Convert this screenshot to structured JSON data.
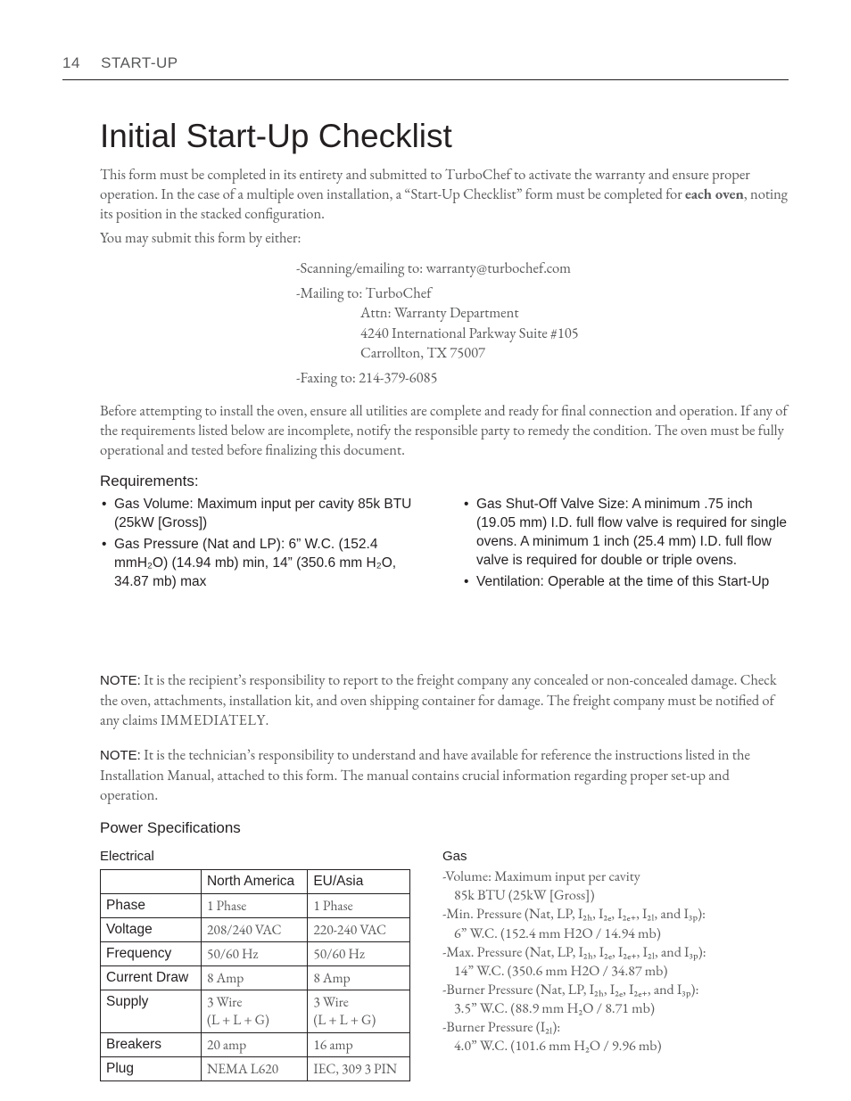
{
  "header": {
    "page_number": "14",
    "section": "START-UP"
  },
  "title": "Initial Start-Up Checklist",
  "intro_part1": "This form must be completed in its entirety and submitted to TurboChef to activate the warranty and ensure proper operation. In the case of a multiple oven installation, a “Start-Up Checklist” form must be completed for ",
  "intro_bold": "each oven",
  "intro_part2": ", noting its position in the stacked configuration.",
  "submit_lead": "You may submit this form by either:",
  "submit": {
    "scan": "-Scanning/emailing to: warranty@turbochef.com",
    "mail_lead": "-Mailing to: TurboChef",
    "mail_l1": "Attn: Warranty Department",
    "mail_l2": "4240 International Parkway Suite #105",
    "mail_l3": "Carrollton, TX 75007",
    "fax": "-Faxing to: 214-379-6085"
  },
  "before": "Before attempting to install the oven, ensure all utilities are complete and ready for final connection and operation. If any of the requirements listed below are incomplete, notify the responsible party to remedy the condition. The oven must be fully operational and tested before finalizing this document.",
  "requirements_heading": "Requirements:",
  "requirements_left": [
    "Gas Volume: Maximum input per cavity 85k BTU (25kW [Gross])",
    "Gas Pressure (Nat and LP): 6” W.C. (152.4 mmH₂O) (14.94 mb) min, 14” (350.6 mm H₂O, 34.87 mb) max"
  ],
  "requirements_right": [
    "Gas Shut-Off Valve Size: A minimum .75 inch (19.05 mm) I.D. full flow valve is required for single ovens. A minimum 1 inch (25.4 mm) I.D. full flow valve is required for double or triple ovens.",
    "Ventilation: Operable at the time of this Start-Up"
  ],
  "note_label": "NOTE:",
  "note1": " It is the recipient’s responsibility to report to the freight company any concealed or non-concealed damage. Check the oven, attachments, installation kit, and oven shipping container for damage. The freight company must be notified of any claims ",
  "note1_caps": "IMMEDIATELY.",
  "note2": " It is the technician’s responsibility to understand and have available for reference the instructions listed in the Installation Manual, attached to this form. The manual contains crucial information regarding proper set-up and operation.",
  "power_heading": "Power Specifications",
  "electrical_label": "Electrical",
  "table": {
    "col1": "North America",
    "col2": "EU/Asia",
    "rows": [
      {
        "h": "Phase",
        "a": "1 Phase",
        "b": "1 Phase"
      },
      {
        "h": "Voltage",
        "a": "208/240 VAC",
        "b": "220-240 VAC"
      },
      {
        "h": "Frequency",
        "a": "50/60 Hz",
        "b": "50/60 Hz"
      },
      {
        "h": "Current Draw",
        "a": "8 Amp",
        "b": "8 Amp"
      },
      {
        "h": "Supply",
        "a": "3 Wire\n(L + L + G)",
        "b": "3 Wire\n(L + L + G)"
      },
      {
        "h": "Breakers",
        "a": "20 amp",
        "b": "16 amp"
      },
      {
        "h": "Plug",
        "a": "NEMA L620",
        "b": "IEC, 309 3 PIN"
      }
    ]
  },
  "gas_label": "Gas",
  "gas": {
    "l1a": "-Volume: Maximum input per cavity",
    "l1b": "85k BTU (25kW [Gross])",
    "l2a": "-Min. Pressure (Nat, LP, I₂ₕ, I₂ₑ, I₂ₑ₊, I₂ₗ, and I₃ₚ):",
    "l2b": "6” W.C. (152.4 mm H2O / 14.94 mb)",
    "l3a": "-Max. Pressure (Nat, LP, I₂ₕ, I₂ₑ, I₂ₑ₊, I₂ₗ, and I₃ₚ):",
    "l3b": "14” W.C. (350.6 mm H2O / 34.87 mb)",
    "l4a": "-Burner Pressure (Nat, LP, I₂ₕ, I₂ₑ, I₂ₑ₊, and I₃ₚ):",
    "l4b": "3.5” W.C. (88.9 mm H₂O / 8.71 mb)",
    "l5a": "-Burner Pressure (I₂ₗ):",
    "l5b": "4.0” W.C. (101.6 mm H₂O / 9.96 mb)"
  }
}
